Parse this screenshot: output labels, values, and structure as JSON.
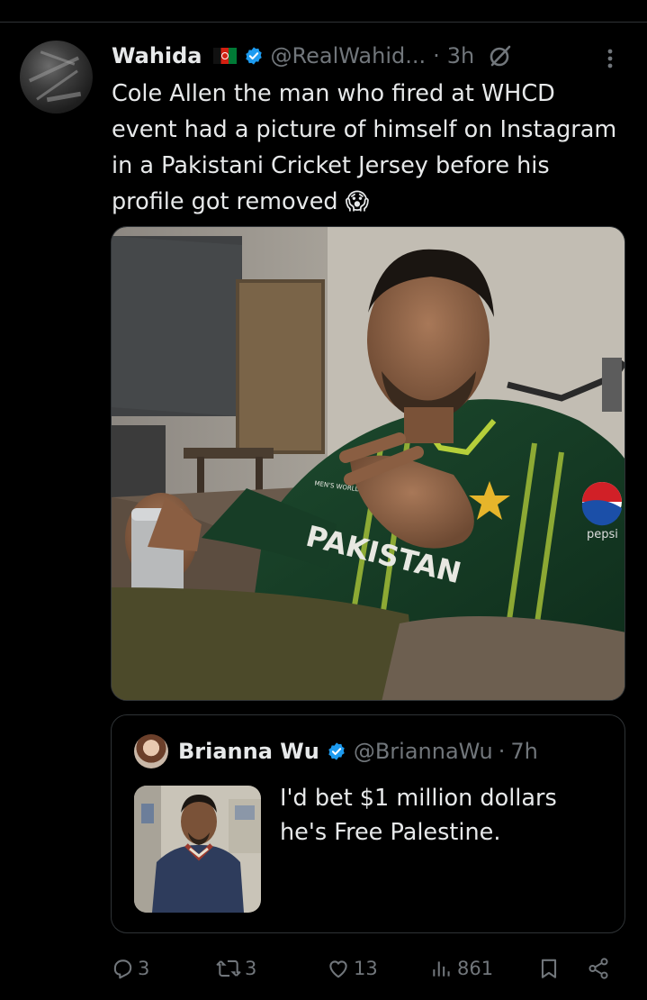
{
  "tweet": {
    "author_name": "Wahida",
    "handle": "@RealWahid...",
    "dot": "·",
    "time": "3h",
    "text": "Cole Allen the man who fired at WHCD event had a picture of himself on Instagram in a Pakistani Cricket Jersey before his profile got removed 😱",
    "photo": {
      "jersey_text": "PAKISTAN",
      "sponsor_text": "pepsi",
      "badge_text": "MEN'S WORLD CUP INDIA 2023"
    }
  },
  "quote": {
    "author_name": "Brianna Wu",
    "handle": "@BriannaWu",
    "dot": "·",
    "time": "7h",
    "text": "I'd bet $1 million dollars he's Free Palestine."
  },
  "actions": {
    "replies": "3",
    "reposts": "3",
    "likes": "13",
    "views": "861"
  },
  "icons": {
    "verified": "verified-badge-icon",
    "grok": "grok-icon",
    "more": "more-icon",
    "reply": "reply-icon",
    "repost": "repost-icon",
    "like": "heart-icon",
    "views": "views-icon",
    "bookmark": "bookmark-icon",
    "share": "share-icon"
  },
  "colors": {
    "background": "#000000",
    "text": "#e7e9ea",
    "muted": "#71767b",
    "verified": "#1d9bf0",
    "border": "#2f3336"
  }
}
